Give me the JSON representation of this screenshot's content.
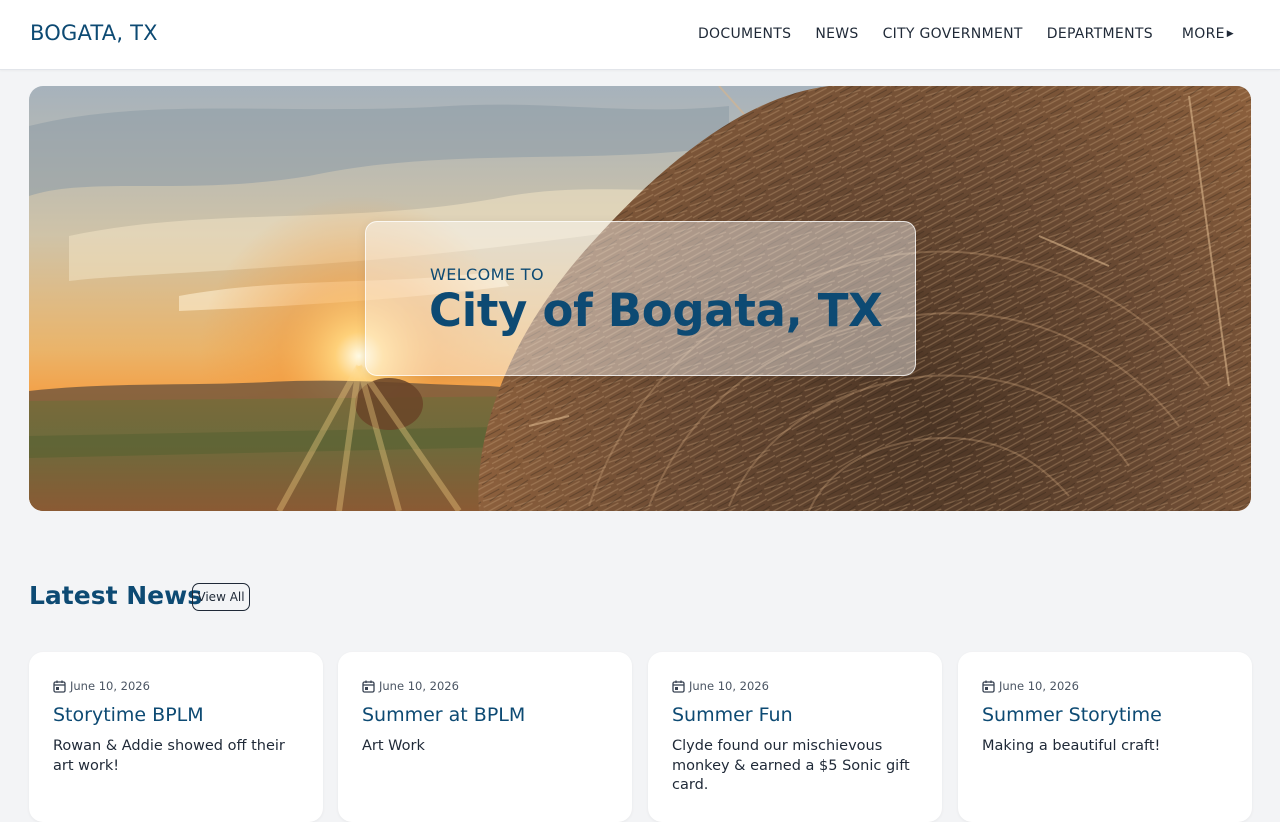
{
  "header": {
    "brand": "BOGATA, TX",
    "nav": [
      {
        "label": "DOCUMENTS"
      },
      {
        "label": "NEWS"
      },
      {
        "label": "CITY GOVERNMENT"
      },
      {
        "label": "DEPARTMENTS"
      },
      {
        "label": "MORE",
        "icon": "caret-right-icon"
      }
    ]
  },
  "hero": {
    "image": "sunset-field-hay-bale-image",
    "kicker": "WELCOME TO",
    "title": "City of Bogata, TX"
  },
  "news": {
    "section_title": "Latest News",
    "view_all_label": "View All",
    "cards": [
      {
        "date": "June 10, 2026",
        "title": "Storytime BPLM",
        "text": "Rowan & Addie showed off their art work!"
      },
      {
        "date": "June 10, 2026",
        "title": "Summer at BPLM",
        "text": "Art Work"
      },
      {
        "date": "June 10, 2026",
        "title": "Summer Fun",
        "text": "Clyde found our mischievous monkey & earned a $5 Sonic gift card."
      },
      {
        "date": "June 10, 2026",
        "title": "Summer Storytime",
        "text": "Making a beautiful craft!"
      }
    ]
  },
  "colors": {
    "brand": "#0d4a73",
    "page_background": "#f3f4f6",
    "card_background": "#ffffff"
  }
}
